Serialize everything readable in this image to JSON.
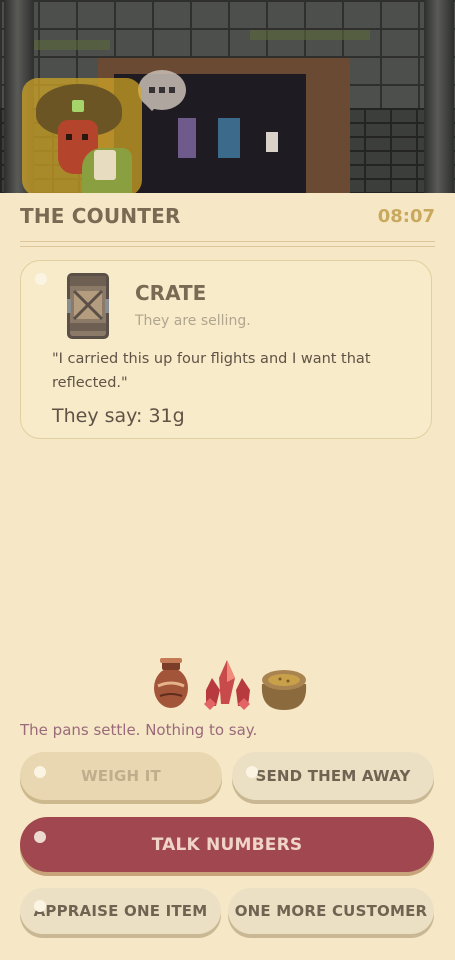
{
  "header": {
    "title": "THE COUNTER",
    "clock": "08:07"
  },
  "offer": {
    "item_name": "CRATE",
    "subtitle": "They are selling.",
    "quote": "\"I carried this up four flights and I want that reflected.\"",
    "price_text": "They say: 31g"
  },
  "scale": {
    "items": [
      "vase-icon",
      "red-crystal-icon",
      "grain-sack-icon"
    ],
    "status": "The pans settle. Nothing to say."
  },
  "actions": {
    "weigh": "WEIGH IT",
    "send_away": "SEND THEM AWAY",
    "talk": "TALK NUMBERS",
    "appraise": "APPRAISE ONE ITEM",
    "next_customer": "ONE MORE CUSTOMER"
  },
  "colors": {
    "background": "#f6e8c6",
    "primary_button": "#a1474f",
    "clock": "#c9a95e",
    "status_text": "#9a6a7a"
  }
}
